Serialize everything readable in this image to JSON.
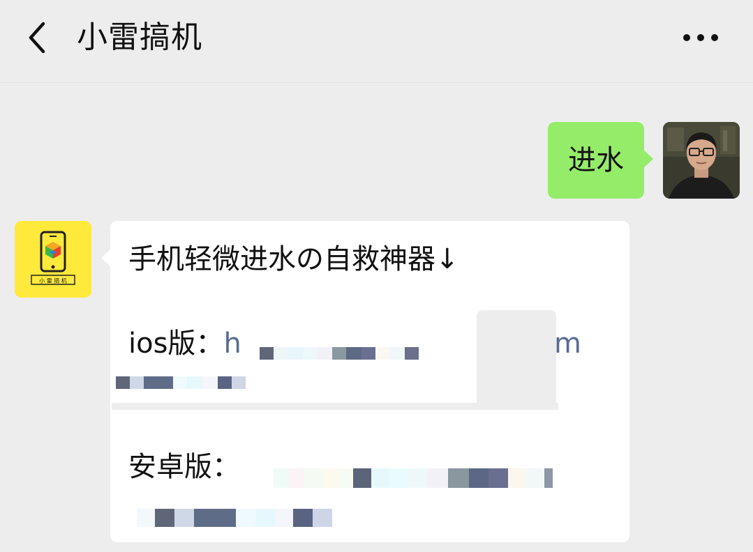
{
  "header": {
    "title": "小雷搞机",
    "back_icon": "chevron-left-icon",
    "more_icon": "more-dots-icon"
  },
  "messages": {
    "sent": {
      "text": "进水",
      "bubble_color": "#95ec69"
    },
    "received": {
      "line1": "手机轻微进水の自救神器↓",
      "ios_label": "ios版：",
      "ios_link_start": "h",
      "ios_link_end": "m",
      "android_label": "安卓版：",
      "link_color": "#576b95"
    }
  },
  "avatars": {
    "user": "user-photo-avatar",
    "bot": "xiaolei-logo-avatar",
    "bot_logo_text": "小 雷 搞 机",
    "bot_bg": "#ffe93b"
  }
}
